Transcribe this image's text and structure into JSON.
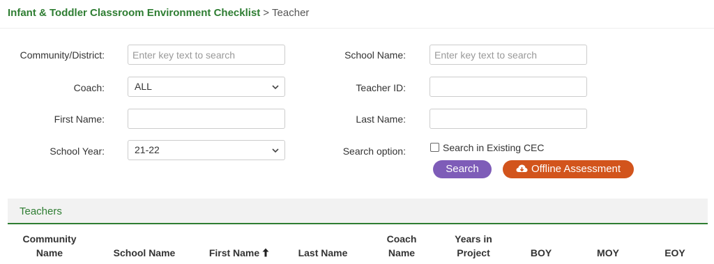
{
  "breadcrumb": {
    "root": "Infant & Toddler Classroom Environment Checklist",
    "separator": ">",
    "current": "Teacher"
  },
  "filters": {
    "community_label": "Community/District:",
    "community_placeholder": "Enter key text to search",
    "school_label": "School Name:",
    "school_placeholder": "Enter key text to search",
    "coach_label": "Coach:",
    "coach_value": "ALL",
    "teacher_id_label": "Teacher ID:",
    "teacher_id_value": "",
    "first_name_label": "First Name:",
    "first_name_value": "",
    "last_name_label": "Last Name:",
    "last_name_value": "",
    "school_year_label": "School Year:",
    "school_year_value": "21-22",
    "search_option_label": "Search option:",
    "existing_cec_label": "Search in Existing CEC",
    "existing_cec_checked": false
  },
  "buttons": {
    "search": "Search",
    "offline": "Offline Assessment"
  },
  "panel": {
    "title": "Teachers"
  },
  "table": {
    "columns": [
      {
        "line1": "Community",
        "line2": "Name"
      },
      {
        "line1": "",
        "line2": "School Name"
      },
      {
        "line1": "",
        "line2": "First Name"
      },
      {
        "line1": "",
        "line2": "Last Name"
      },
      {
        "line1": "Coach",
        "line2": "Name"
      },
      {
        "line1": "Years in",
        "line2": "Project"
      },
      {
        "line1": "",
        "line2": "BOY"
      },
      {
        "line1": "",
        "line2": "MOY"
      },
      {
        "line1": "",
        "line2": "EOY"
      }
    ],
    "sorted_column": "First Name",
    "sort_direction": "ascending"
  },
  "colors": {
    "brand_green": "#2e7d32",
    "search_purple": "#7e5cb8",
    "offline_orange": "#d2541c"
  },
  "icons": {
    "chevron": "chevron-down-icon",
    "cloud": "cloud-download-icon",
    "sort": "arrow-up-icon"
  }
}
